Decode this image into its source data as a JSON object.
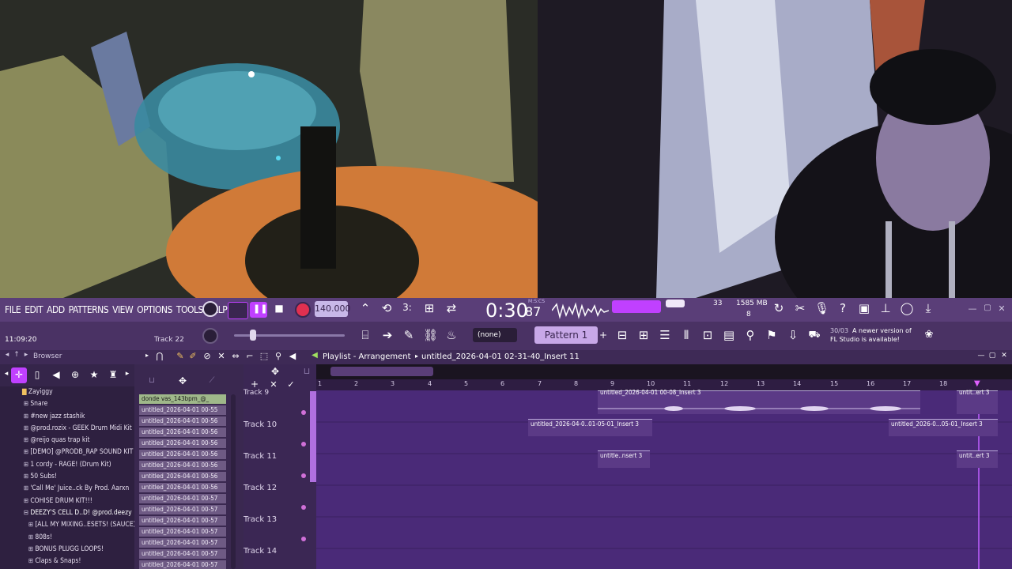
{
  "menu": [
    "FILE",
    "EDIT",
    "ADD",
    "PATTERNS",
    "VIEW",
    "OPTIONS",
    "TOOLS",
    "HELP"
  ],
  "transport": {
    "tempo": "140.000",
    "time": "0:30",
    "time_sub": "87",
    "time_label": "M:S:CS",
    "cpu": "33",
    "memory": "1585 MB",
    "voices": "8",
    "pattern_label": "Pattern 1",
    "snap_label": "(none)",
    "clock": "11:09:20",
    "track_hint": "Track 22"
  },
  "notice": {
    "date": "30/03",
    "text_1": "A newer version of",
    "text_2": "FL Studio is available!"
  },
  "browser": {
    "title": "Browser",
    "items": [
      "Zayiggy",
      "Snare",
      "#new jazz stashik",
      "@prod.rozix - GEEK Drum Midi Kit",
      "@reijo quas trap kit",
      "[DEMO] @PRODB_RAP SOUND KIT",
      "1 cordy - RAGE! (Drum Kit)",
      "50 Subs!",
      "'Call Me' Juice..ck By Prod. Aarxn",
      "COHISE DRUM KIT!!!",
      "DEEZY'S CELL D..D! @prod.deezy",
      "[ALL MY MIXING..ESETS! (SAUCE)",
      "808s!",
      "BONUS PLUGG LOOPS!",
      "Claps & Snaps!"
    ]
  },
  "channels": [
    "donde vas_143bpm_@_",
    "untitled_2026-04-01 00-55",
    "untitled_2026-04-01 00-56",
    "untitled_2026-04-01 00-56",
    "untitled_2026-04-01 00-56",
    "untitled_2026-04-01 00-56",
    "untitled_2026-04-01 00-56",
    "untitled_2026-04-01 00-56",
    "untitled_2026-04-01 00-56",
    "untitled_2026-04-01 00-57",
    "untitled_2026-04-01 00-57",
    "untitled_2026-04-01 00-57",
    "untitled_2026-04-01 00-57",
    "untitled_2026-04-01 00-57",
    "untitled_2026-04-01 00-57",
    "untitled_2026-04-01 00-57"
  ],
  "playlist": {
    "title": "Playlist - Arrangement",
    "project": "untitled_2026-04-01 02-31-40_Insert 11",
    "ruler": [
      "1",
      "2",
      "3",
      "4",
      "5",
      "6",
      "7",
      "8",
      "9",
      "10",
      "11",
      "12",
      "13",
      "14",
      "15",
      "16",
      "17",
      "18"
    ],
    "tracks": [
      "Track 9",
      "Track 10",
      "Track 11",
      "Track 12",
      "Track 13",
      "Track 14"
    ],
    "clips": {
      "t9_a": "untitled_2026-04-01 00-08_Insert 3",
      "t9_b": "untit..ert 3",
      "t10_a": "untitled_2026-04-0..01-05-01_Insert 3",
      "t10_b": "untitled_2026-0...05-01_Insert 3",
      "t11_a": "untitle..nsert 3",
      "t11_b": "untit..ert 3"
    }
  },
  "colors": {
    "accent": "#c040ff",
    "menu_bg": "#5a3e78",
    "grid_bg": "#4a2a78",
    "record": "#e03050",
    "tempo_bg": "#c8b8e8"
  }
}
